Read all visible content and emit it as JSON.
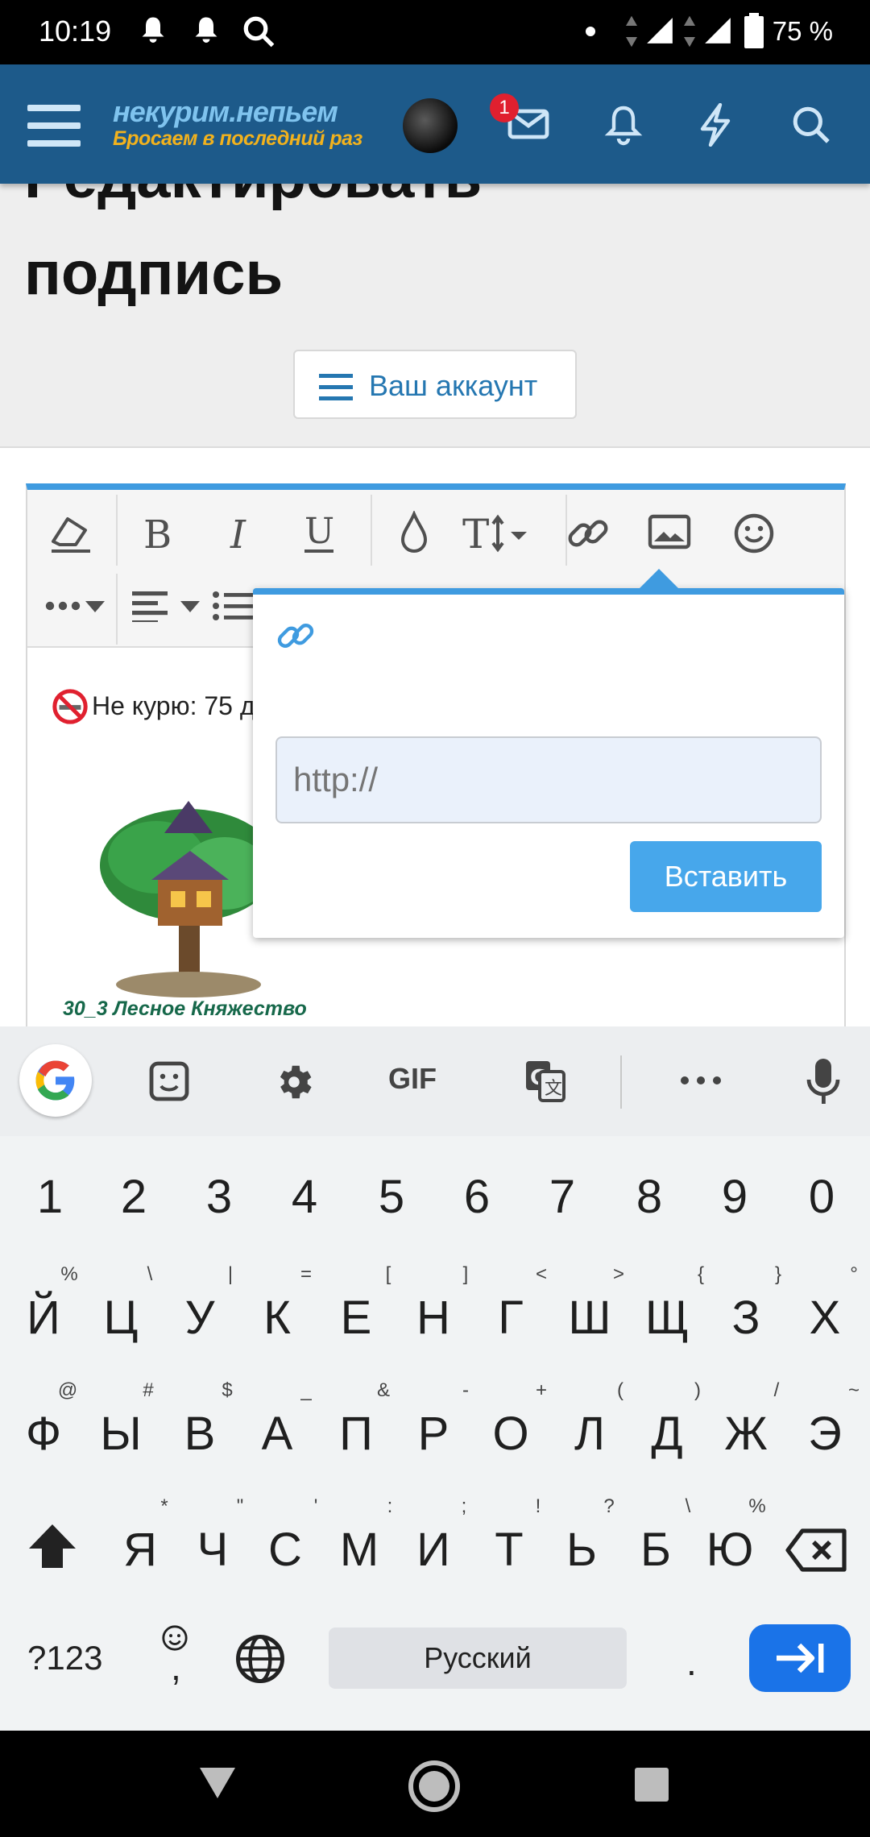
{
  "status_bar": {
    "time": "10:19",
    "battery": "75 %"
  },
  "header": {
    "logo_main": "некурим.непьем",
    "logo_sub": "Бросаем в последний раз",
    "mail_badge": "1"
  },
  "page": {
    "title_line1": "Редактировать",
    "title_line2": "подпись",
    "account_button": "Ваш аккаунт"
  },
  "editor": {
    "signature_text": "Не курю: 75 д",
    "image_caption": "30_3 Лесное Княжество"
  },
  "link_popup": {
    "url_placeholder": "http://",
    "insert_button": "Вставить"
  },
  "keyboard": {
    "gif_label": "GIF",
    "number_row": [
      "1",
      "2",
      "3",
      "4",
      "5",
      "6",
      "7",
      "8",
      "9",
      "0"
    ],
    "row1": [
      "Й",
      "Ц",
      "У",
      "К",
      "Е",
      "Н",
      "Г",
      "Ш",
      "Щ",
      "З",
      "Х"
    ],
    "row1_hints": [
      "%",
      "\\",
      "|",
      "=",
      "[",
      "]",
      "<",
      ">",
      "{",
      "}",
      "°"
    ],
    "row2": [
      "Ф",
      "Ы",
      "В",
      "А",
      "П",
      "Р",
      "О",
      "Л",
      "Д",
      "Ж",
      "Э"
    ],
    "row2_hints": [
      "@",
      "#",
      "$",
      "_",
      "&",
      "-",
      "+",
      "(",
      ")",
      "/",
      "~"
    ],
    "row3": [
      "Я",
      "Ч",
      "С",
      "М",
      "И",
      "Т",
      "Ь",
      "Б",
      "Ю"
    ],
    "row3_hints": [
      "*",
      "\"",
      "'",
      ":",
      ";",
      "!",
      "?",
      "\\",
      "%"
    ],
    "symbols_key": "?123",
    "comma_key": ",",
    "space_label": "Русский",
    "period_key": "."
  }
}
